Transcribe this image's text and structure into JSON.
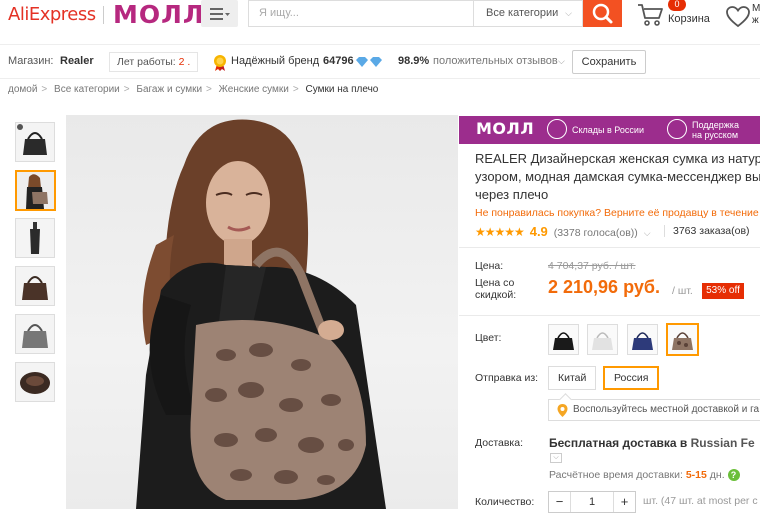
{
  "header": {
    "logo": "AliExpress",
    "mall_logo": "МОЛЛ",
    "menu_icon": "hamburger-menu-icon",
    "search_placeholder": "Я ищу...",
    "category_select": "Все категории",
    "cart_count": "0",
    "cart_label": "Корзина",
    "wishlist_label_1": "М",
    "wishlist_label_2": "ж"
  },
  "store": {
    "label": "Магазин:",
    "name": "Realer",
    "years_label": "Лет работы:",
    "years_value": "2",
    "trusted_label": "Надёжный бренд",
    "feedback_score": "64796",
    "positive_pct": "98.9%",
    "positive_label": "положительных отзывов",
    "save_button": "Сохранить"
  },
  "breadcrumb": [
    "домой",
    "Все категории",
    "Багаж и сумки",
    "Женские сумки",
    "Сумки на плечо"
  ],
  "mall_bar": {
    "label": "МОЛЛ",
    "feature1": "Склады в России",
    "feature2_line1": "Поддержка",
    "feature2_line2": "на русском"
  },
  "product": {
    "title_line1": "REALER Дизайнерская женская сумка из натур",
    "title_line2": "узором, модная дамская сумка-мессенджер вы",
    "title_line3": "через плечо",
    "return_note": "Не понравилась покупка? Верните её продавцу в течение",
    "stars": "★★★★★",
    "rating": "4.9",
    "votes": "(3378 голоса(ов))",
    "orders": "3763 заказа(ов)"
  },
  "price": {
    "price_label": "Цена:",
    "old_price": "4 704,37 руб. / шт.",
    "discount_label_1": "Цена со",
    "discount_label_2": "скидкой:",
    "new_price": "2 210,96 руб.",
    "unit": "/ шт.",
    "discount_badge": "53% off"
  },
  "options": {
    "color_label": "Цвет:",
    "ship_from_label": "Отправка из:",
    "ship_from_options": [
      "Китай",
      "Россия"
    ],
    "tip": "Воспользуйтесь местной доставкой и га"
  },
  "delivery": {
    "label": "Доставка:",
    "value_bold": "Бесплатная доставка в",
    "value_dest": "Russian Fe",
    "est_label": "Расчётное время доставки:",
    "est_value": "5-15",
    "est_unit": "дн.",
    "help": "?"
  },
  "quantity": {
    "label": "Количество:",
    "minus": "−",
    "value": "1",
    "plus": "+",
    "stock": "шт. (47 шт. at most per c"
  },
  "colors": {
    "brand_red": "#e43225",
    "mall_purple": "#9c2d8d",
    "price_orange": "#f26b0a",
    "selected_border": "#ff9900"
  }
}
